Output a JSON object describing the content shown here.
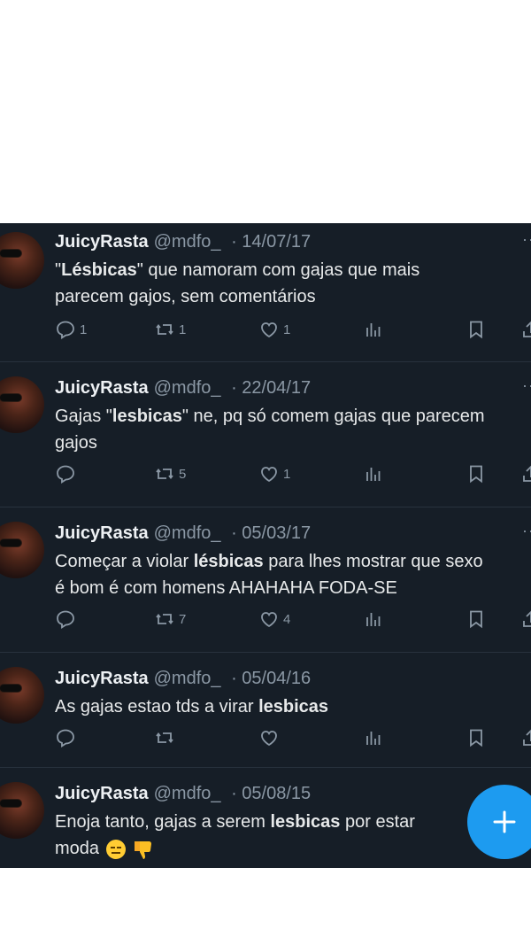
{
  "tweets": [
    {
      "name": "JuicyRasta",
      "handle": "@mdfo_",
      "date": "· 14/07/17",
      "line1_pre": "\"",
      "line1_bold": "Lésbicas",
      "line1_post": "\" que namoram com gajas que mais",
      "line2": "parecem gajos, sem comentários",
      "replies": "1",
      "retweets": "1",
      "likes": "1"
    },
    {
      "name": "JuicyRasta",
      "handle": "@mdfo_",
      "date": "· 22/04/17",
      "line1_pre": "Gajas \"",
      "line1_bold": "lesbicas",
      "line1_post": "\" ne, pq só comem gajas que parecem",
      "line2": "gajos",
      "replies": "",
      "retweets": "5",
      "likes": "1"
    },
    {
      "name": "JuicyRasta",
      "handle": "@mdfo_",
      "date": "· 05/03/17",
      "line1_pre": "Começar a violar ",
      "line1_bold": "lésbicas",
      "line1_post": " para lhes mostrar que sexo",
      "line2": "é bom é com homens AHAHAHA FODA-SE",
      "replies": "",
      "retweets": "7",
      "likes": "4"
    },
    {
      "name": "JuicyRasta",
      "handle": "@mdfo_",
      "date": "· 05/04/16",
      "line1_pre": "As gajas estao tds a virar ",
      "line1_bold": "lesbicas",
      "line1_post": "",
      "line2": "",
      "replies": "",
      "retweets": "",
      "likes": ""
    },
    {
      "name": "JuicyRasta",
      "handle": "@mdfo_",
      "date": "· 05/08/15",
      "line1_pre": "Enoja tanto, gajas a serem ",
      "line1_bold": "lesbicas",
      "line1_post": " por estar",
      "line2": "moda"
    }
  ],
  "icons": {
    "reply": "reply-icon",
    "retweet": "retweet-icon",
    "like": "heart-icon",
    "views": "views-icon",
    "bookmark": "bookmark-icon",
    "share": "share-icon",
    "compose": "plus-icon",
    "emoji1": "expressionless-face-emoji",
    "emoji2": "thumbs-down-emoji"
  },
  "colors": {
    "background": "#161e27",
    "accent": "#1d9bf0",
    "text": "#e7e9ea",
    "muted": "#8b98a5"
  }
}
